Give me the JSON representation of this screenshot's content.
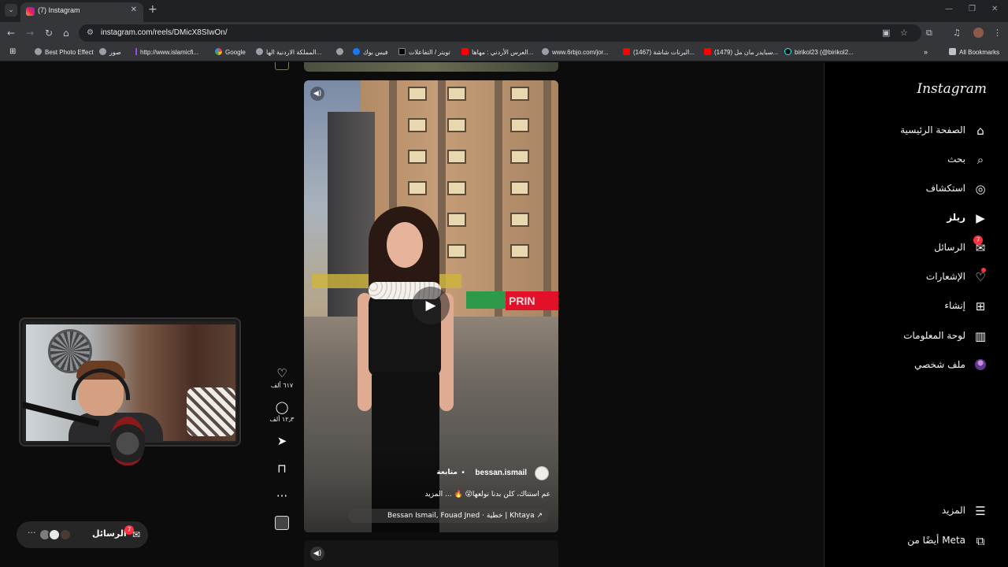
{
  "browser": {
    "tab_title": "(7) Instagram",
    "tab_close": "✕",
    "new_tab": "+",
    "url": "instagram.com/reels/DMicX8SIwOn/",
    "window_controls": [
      "—",
      "❐",
      "✕"
    ]
  },
  "bookmarks": [
    {
      "label": "Best Photo Effect",
      "icon": "globe-icon"
    },
    {
      "label": "صور",
      "icon": "globe-icon"
    },
    {
      "label": "http://www.islamicfi...",
      "icon": "bar-icon"
    },
    {
      "label": "Google",
      "icon": "google-icon"
    },
    {
      "label": "المملكة الاردنية الها...",
      "icon": "globe-icon"
    },
    {
      "label": "",
      "icon": "globe-icon"
    },
    {
      "label": "فيس بوك",
      "icon": "facebook-icon"
    },
    {
      "label": "تويتر / التفاعلات",
      "icon": "x-icon"
    },
    {
      "label": "العرس الأردني : مهاها...",
      "icon": "youtube-icon"
    },
    {
      "label": "www.6rbjo.com/jor...",
      "icon": "globe-icon"
    },
    {
      "label": "(1467) البرنات شاشة...",
      "icon": "youtube-icon"
    },
    {
      "label": "(1479) سبايدر مان مل...",
      "icon": "youtube-icon"
    },
    {
      "label": "birikol23 (@birikol2...",
      "icon": "tiktok-icon"
    }
  ],
  "all_bookmarks": "All Bookmarks",
  "nav": {
    "logo": "Instagram",
    "items": [
      {
        "label": "الصفحة الرئيسية",
        "icon": "⌂",
        "name": "home"
      },
      {
        "label": "بحث",
        "icon": "⌕",
        "name": "search"
      },
      {
        "label": "استكشاف",
        "icon": "◎",
        "name": "explore"
      },
      {
        "label": "ريلز",
        "icon": "▶",
        "name": "reels"
      },
      {
        "label": "الرسائل",
        "icon": "✉",
        "name": "messages",
        "badge": "7"
      },
      {
        "label": "الإشعارات",
        "icon": "♡",
        "name": "notifications"
      },
      {
        "label": "إنشاء",
        "icon": "⊞",
        "name": "create"
      },
      {
        "label": "لوحة المعلومات",
        "icon": "▥",
        "name": "dashboard"
      },
      {
        "label": "ملف شخصي",
        "icon": "",
        "name": "profile"
      }
    ],
    "more": "المزيد",
    "meta": "أيضًا من Meta"
  },
  "reel": {
    "signboard": "PRIN",
    "owner": "bessan.ismail",
    "follow": "متابعة",
    "caption": "عم استناك، كلن بدنا نولعها😮 🔥 ... المزيد",
    "audio": "Bessan Ismail, Fouad Jned · خطية | Khtaya ↗"
  },
  "actions": {
    "likes": "٦١٧ ألف",
    "comments": "١٢٫٣ ألف"
  },
  "messages_pill": {
    "label": "الرسائل",
    "badge": "7",
    "more": "···"
  }
}
